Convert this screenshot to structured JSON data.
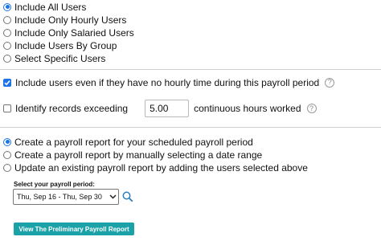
{
  "user_filter": {
    "options": [
      {
        "label": "Include All Users",
        "selected": true
      },
      {
        "label": "Include Only Hourly Users",
        "selected": false
      },
      {
        "label": "Include Only Salaried Users",
        "selected": false
      },
      {
        "label": "Include Users By Group",
        "selected": false
      },
      {
        "label": "Select Specific Users",
        "selected": false
      }
    ]
  },
  "no_hourly_option": {
    "label": "Include users even if they have no hourly time during this payroll period",
    "checked": true,
    "help_icon": "question-circle-icon"
  },
  "records_option": {
    "label": "Identify records exceeding",
    "checked": false,
    "hours_value": "5.00",
    "suffix": "continuous hours worked",
    "help_icon": "question-circle-icon"
  },
  "report_mode": {
    "options": [
      {
        "label": "Create a payroll report for your scheduled payroll period",
        "selected": true
      },
      {
        "label": "Create a payroll report by manually selecting a date range",
        "selected": false
      },
      {
        "label": "Update an existing payroll report by adding the users selected above",
        "selected": false
      }
    ]
  },
  "payroll_period": {
    "label": "Select your payroll period:",
    "selected": "Thu, Sep 16 - Thu, Sep 30",
    "search_icon": "magnifier-icon"
  },
  "preview_button": {
    "label": "View The Preliminary Payroll Report"
  },
  "colors": {
    "accent": "#1a73e8",
    "button": "#1aa2a8"
  }
}
